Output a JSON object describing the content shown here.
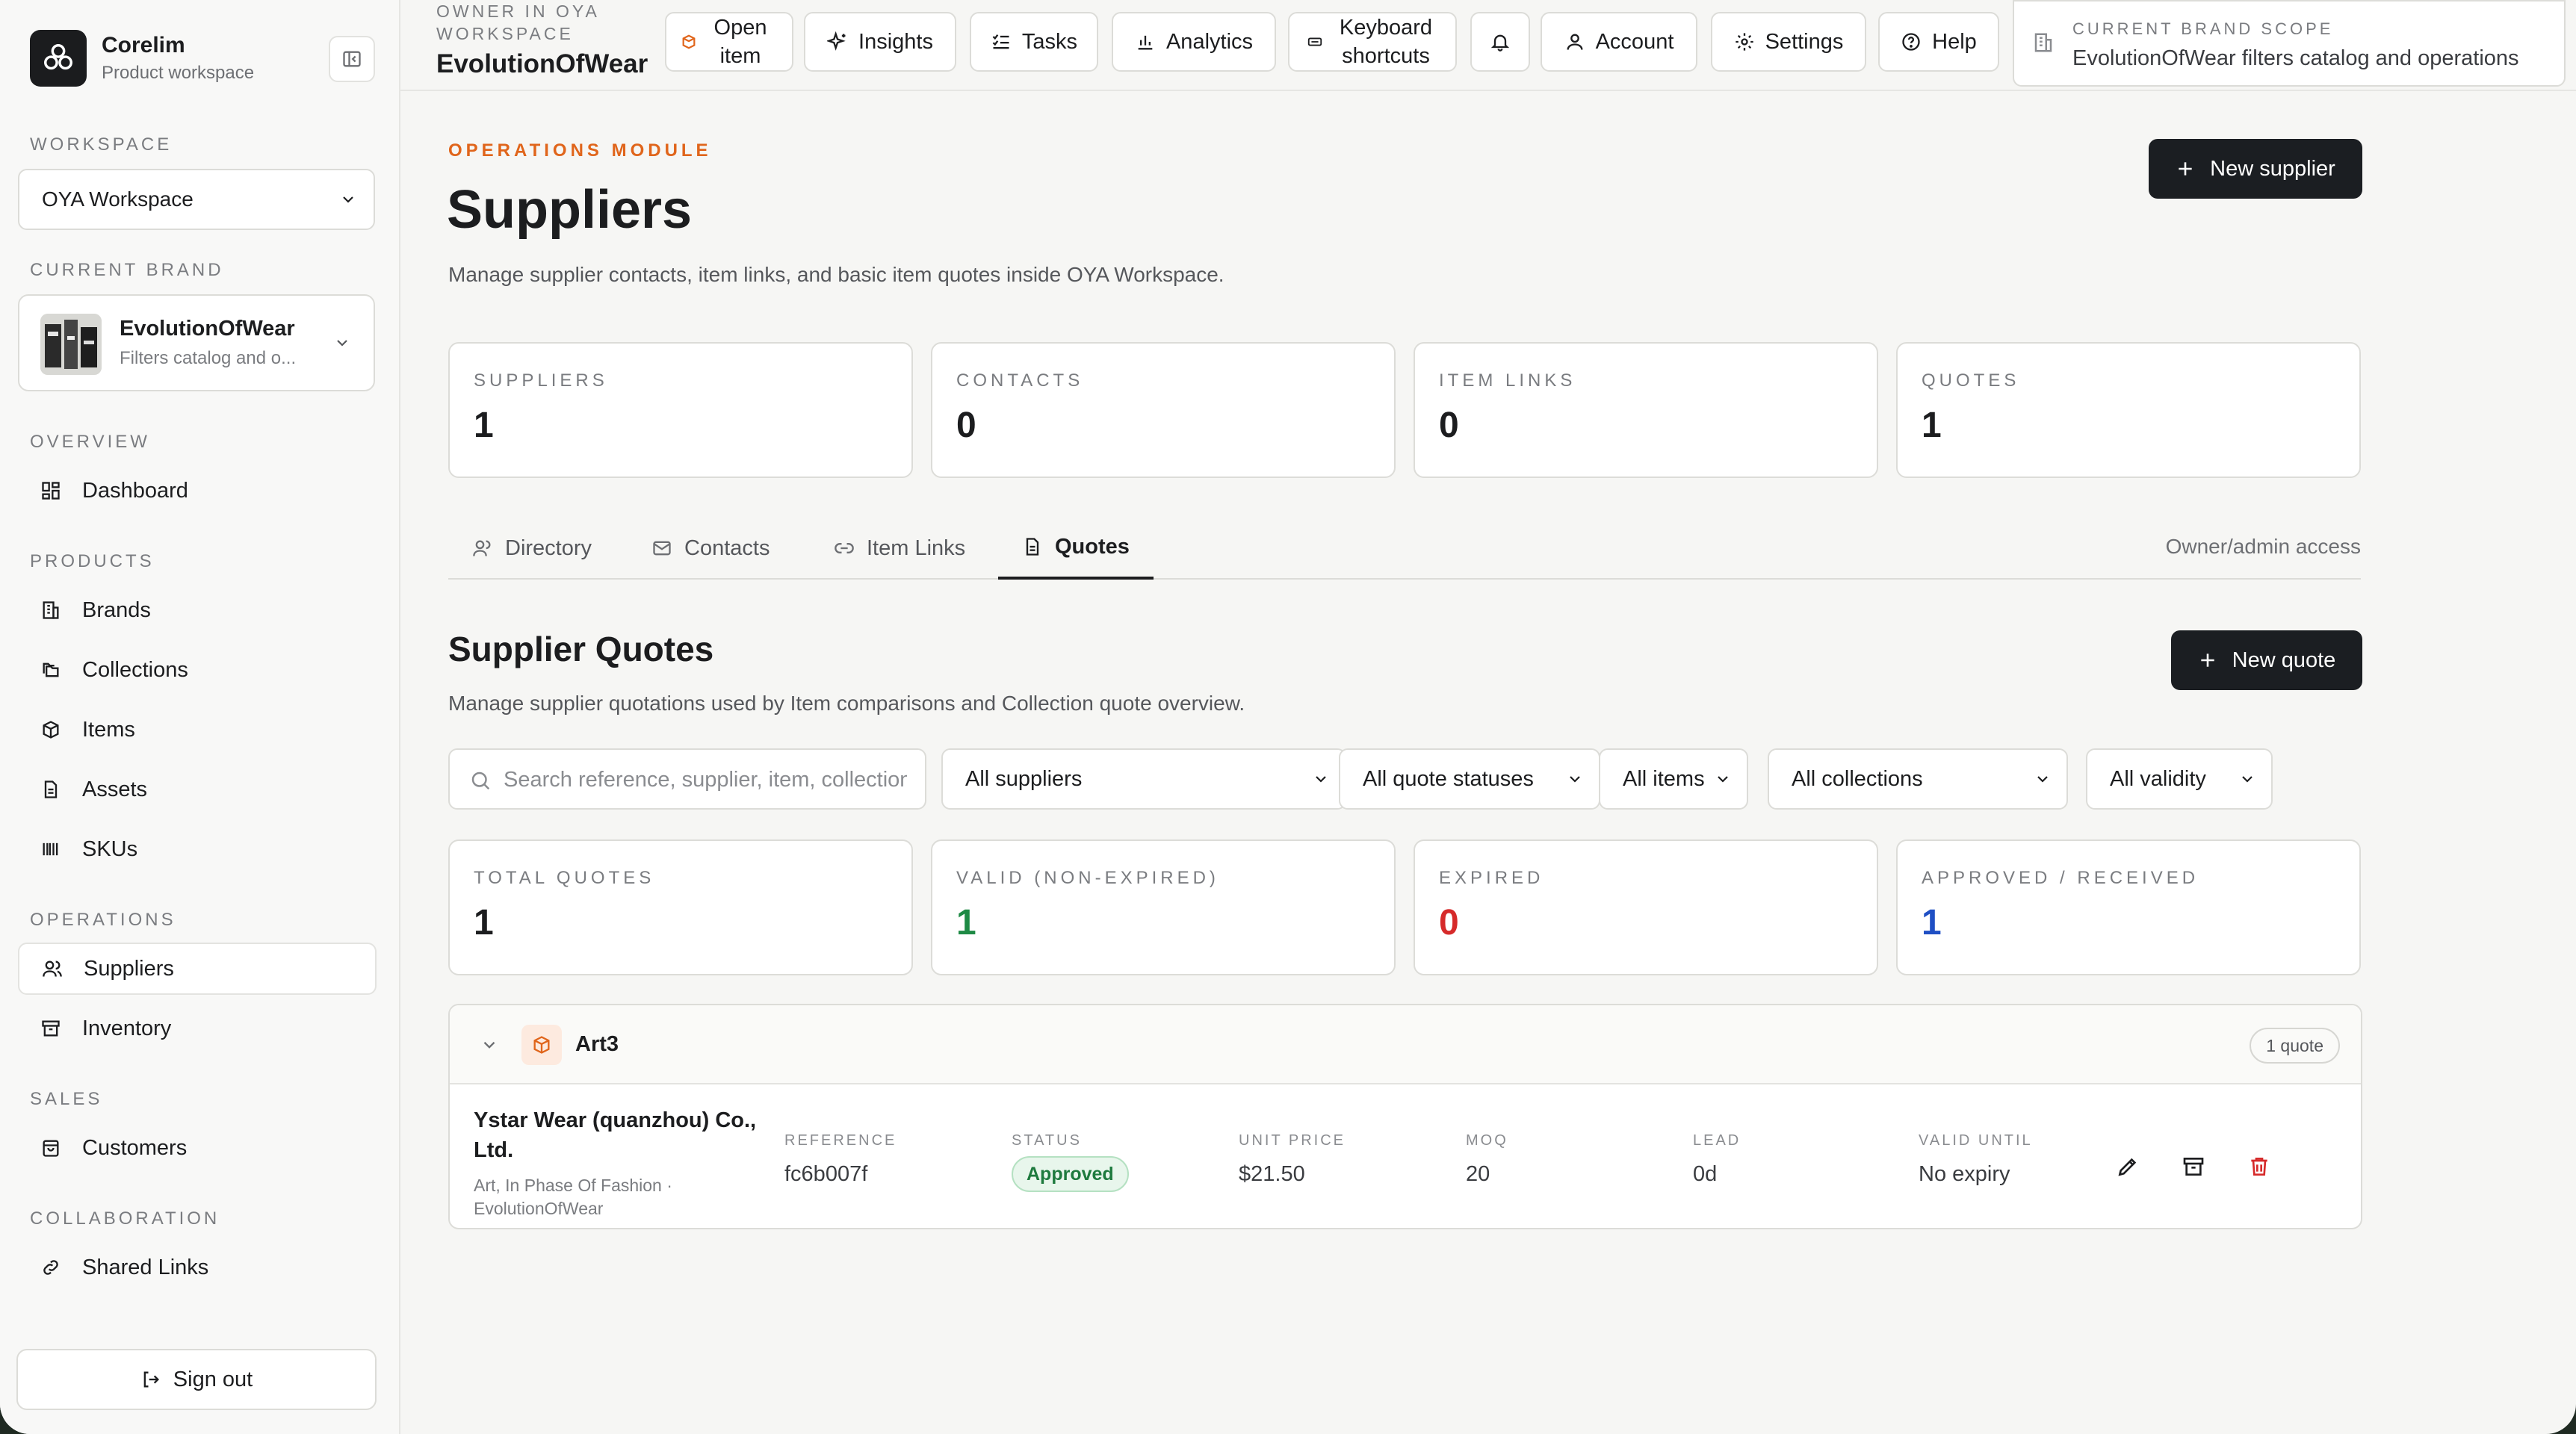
{
  "sidebar": {
    "app_name": "Corelim",
    "app_sub": "Product workspace",
    "workspace_label": "WORKSPACE",
    "workspace_value": "OYA Workspace",
    "current_brand_label": "CURRENT BRAND",
    "brand_name": "EvolutionOfWear",
    "brand_sub": "Filters catalog and o...",
    "sections": {
      "overview": "OVERVIEW",
      "products": "PRODUCTS",
      "operations": "OPERATIONS",
      "sales": "SALES",
      "collaboration": "COLLABORATION"
    },
    "items": {
      "dashboard": "Dashboard",
      "brands": "Brands",
      "collections": "Collections",
      "items": "Items",
      "assets": "Assets",
      "skus": "SKUs",
      "suppliers": "Suppliers",
      "inventory": "Inventory",
      "customers": "Customers",
      "shared_links": "Shared Links"
    },
    "sign_out": "Sign out"
  },
  "topbar": {
    "owner_label": "OWNER IN OYA WORKSPACE",
    "owner_name": "EvolutionOfWear",
    "open_item": "Open item",
    "insights": "Insights",
    "tasks": "Tasks",
    "analytics": "Analytics",
    "keyboard_shortcuts": "Keyboard shortcuts",
    "account": "Account",
    "settings": "Settings",
    "help": "Help",
    "scope_label": "CURRENT BRAND SCOPE",
    "scope_text": "EvolutionOfWear filters catalog and operations"
  },
  "page": {
    "eyebrow": "OPERATIONS MODULE",
    "title": "Suppliers",
    "description": "Manage supplier contacts, item links, and basic item quotes inside OYA Workspace.",
    "new_supplier": "New supplier",
    "stats": [
      {
        "label": "SUPPLIERS",
        "value": "1"
      },
      {
        "label": "CONTACTS",
        "value": "0"
      },
      {
        "label": "ITEM LINKS",
        "value": "0"
      },
      {
        "label": "QUOTES",
        "value": "1"
      }
    ],
    "tabs": {
      "directory": "Directory",
      "contacts": "Contacts",
      "item_links": "Item Links",
      "quotes": "Quotes"
    },
    "access_note": "Owner/admin access"
  },
  "quotes": {
    "title": "Supplier Quotes",
    "description": "Manage supplier quotations used by Item comparisons and Collection quote overview.",
    "new_quote": "New quote",
    "search_placeholder": "Search reference, supplier, item, collection",
    "filters": {
      "suppliers": "All suppliers",
      "statuses": "All quote statuses",
      "items": "All items",
      "collections": "All collections",
      "validity": "All validity"
    },
    "stats": [
      {
        "label": "TOTAL QUOTES",
        "value": "1",
        "color": "#1c1d1f"
      },
      {
        "label": "VALID (NON-EXPIRED)",
        "value": "1",
        "color": "#1e8a45"
      },
      {
        "label": "EXPIRED",
        "value": "0",
        "color": "#d62a2a"
      },
      {
        "label": "APPROVED / RECEIVED",
        "value": "1",
        "color": "#1f4fc4"
      }
    ],
    "group": {
      "name": "Art3",
      "count": "1 quote",
      "row": {
        "supplier": "Ystar Wear (quanzhou) Co., Ltd.",
        "sub": "Art, In Phase Of Fashion · EvolutionOfWear",
        "reference_label": "REFERENCE",
        "reference": "fc6b007f",
        "status_label": "STATUS",
        "status": "Approved",
        "unit_price_label": "UNIT PRICE",
        "unit_price": "$21.50",
        "moq_label": "MOQ",
        "moq": "20",
        "lead_label": "LEAD",
        "lead": "0d",
        "valid_until_label": "VALID UNTIL",
        "valid_until": "No expiry"
      }
    }
  },
  "colors": {
    "accent_orange": "#e0651b",
    "dark_button": "#1b1e22",
    "delete_red": "#d62a2a"
  }
}
